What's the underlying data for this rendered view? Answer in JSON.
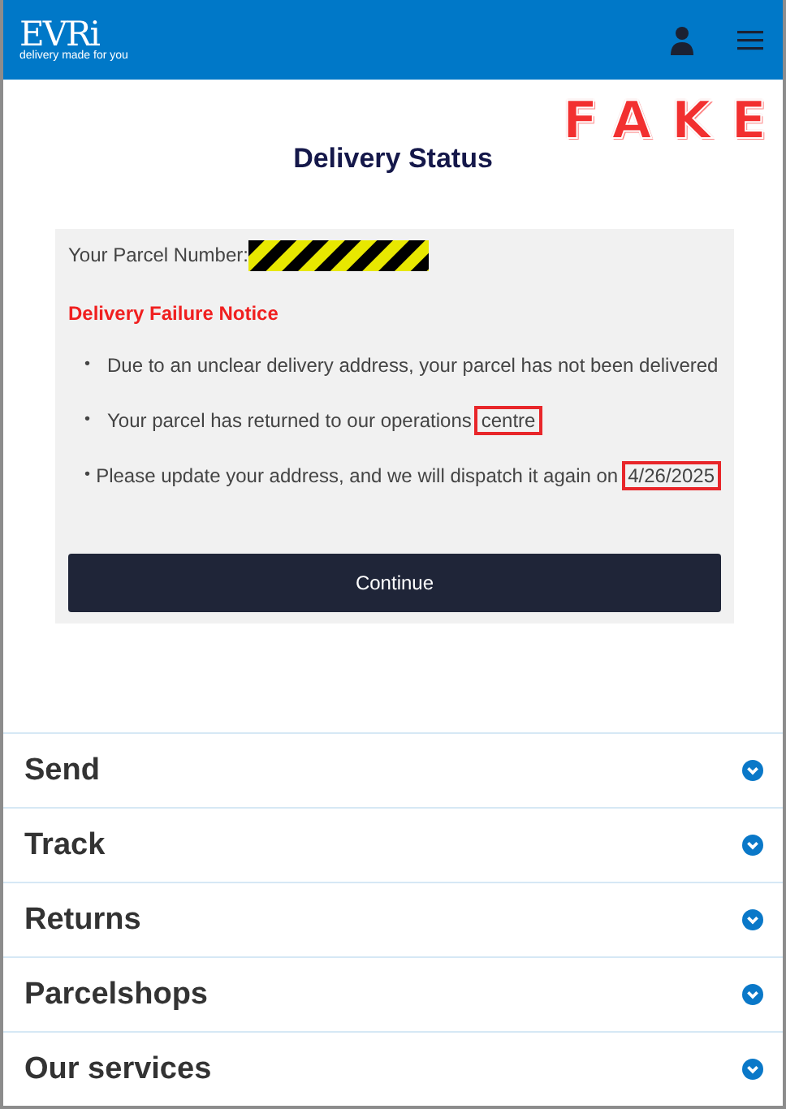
{
  "header": {
    "logo": "EVRi",
    "tagline": "delivery made for you"
  },
  "stamp": "FAKE",
  "title": "Delivery Status",
  "card": {
    "parcel_label": "Your Parcel Number:",
    "notice": "Delivery Failure Notice",
    "bullets": [
      {
        "marker": "•",
        "text": "Due to an unclear delivery address, your parcel has not been delivered"
      },
      {
        "marker": "•",
        "text": "Your parcel has returned to our operations",
        "boxed": "centre"
      },
      {
        "marker": "•",
        "text": "Please update your address, and we will dispatch it again on",
        "boxed": "4/26/2025"
      }
    ],
    "button": "Continue"
  },
  "menu": [
    {
      "label": "Send"
    },
    {
      "label": "Track"
    },
    {
      "label": "Returns"
    },
    {
      "label": "Parcelshops"
    },
    {
      "label": "Our services"
    }
  ]
}
